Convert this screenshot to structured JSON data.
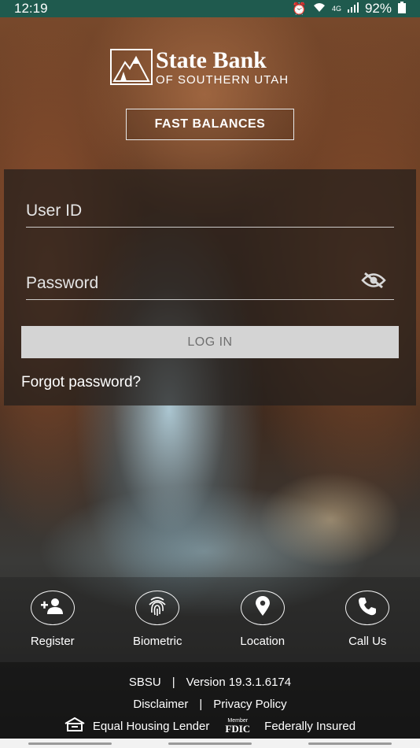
{
  "status_bar": {
    "time": "12:19",
    "network": "4G",
    "battery": "92%"
  },
  "logo": {
    "title": "State Bank",
    "subtitle": "OF SOUTHERN UTAH"
  },
  "fast_balances_label": "FAST BALANCES",
  "login": {
    "user_id_placeholder": "User ID",
    "password_placeholder": "Password",
    "login_label": "LOG IN",
    "forgot_label": "Forgot password?"
  },
  "actions": [
    {
      "label": "Register",
      "icon": "add-user-icon"
    },
    {
      "label": "Biometric",
      "icon": "fingerprint-icon"
    },
    {
      "label": "Location",
      "icon": "location-pin-icon"
    },
    {
      "label": "Call Us",
      "icon": "phone-icon"
    }
  ],
  "footer": {
    "code": "SBSU",
    "version": "Version 19.3.1.6174",
    "disclaimer": "Disclaimer",
    "privacy": "Privacy Policy",
    "equal_housing": "Equal Housing Lender",
    "fdic_small": "Member",
    "fdic": "FDIC",
    "federally_insured": "Federally Insured",
    "divider": "|"
  },
  "colors": {
    "status_bar": "#1f5a4e",
    "login_button": "#d4d4d4",
    "login_text": "#6f6f6f"
  }
}
